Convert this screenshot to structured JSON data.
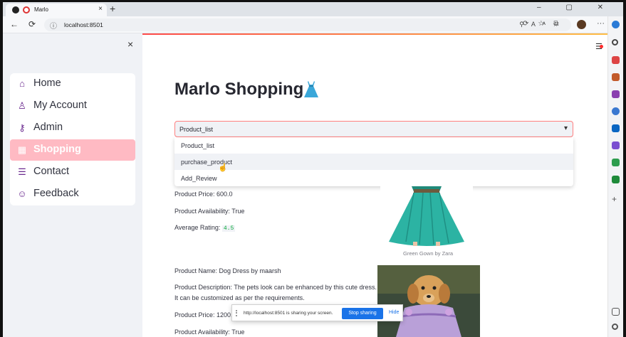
{
  "browser": {
    "tab_title": "Marlo",
    "tab_close": "×",
    "new_tab": "+",
    "window_controls": "– ▢ ✕",
    "back": "←",
    "reload": "⟳",
    "url": "localhost:8501",
    "more": "···"
  },
  "sidebar": {
    "close": "×",
    "items": [
      {
        "label": "Home",
        "icon": "⌂",
        "icon_name": "home-icon",
        "active": false
      },
      {
        "label": "My Account",
        "icon": "♙",
        "icon_name": "person-icon",
        "active": false
      },
      {
        "label": "Admin",
        "icon": "⚷",
        "icon_name": "key-icon",
        "active": false
      },
      {
        "label": "Shopping",
        "icon": "▦",
        "icon_name": "shop-icon",
        "active": true
      },
      {
        "label": "Contact",
        "icon": "☰",
        "icon_name": "contact-card-icon",
        "active": false
      },
      {
        "label": "Feedback",
        "icon": "☺",
        "icon_name": "chat-bubble-icon",
        "active": false
      }
    ]
  },
  "main": {
    "title": "Marlo Shopping",
    "select": {
      "value": "Product_list",
      "options": [
        "Product_list",
        "purchase_product",
        "Add_Review"
      ]
    },
    "product1": {
      "price_line": "Product Price: 600.0",
      "availability_line": "Product Availability: True",
      "rating_label": "Average Rating:",
      "rating_value": "4.5",
      "image_caption": "Green Gown by Zara"
    },
    "product2": {
      "name_line": "Product Name: Dog Dress by maarsh",
      "desc_line1": "Product Description: The pets look can be enhanced by this cute dress.",
      "desc_line2": "It can be customized as per the requirements.",
      "price_line": "Product Price: 1200.0",
      "availability_line": "Product Availability: True"
    }
  },
  "share_bar": {
    "message": "http://localhost:8501 is sharing your screen.",
    "stop_label": "Stop sharing",
    "hide_label": "Hide"
  },
  "colors": {
    "accent": "#ff4b4b",
    "active_menu": "#ffbac3",
    "icon_purple": "#6b2a8f",
    "share_button": "#1a73e8"
  }
}
